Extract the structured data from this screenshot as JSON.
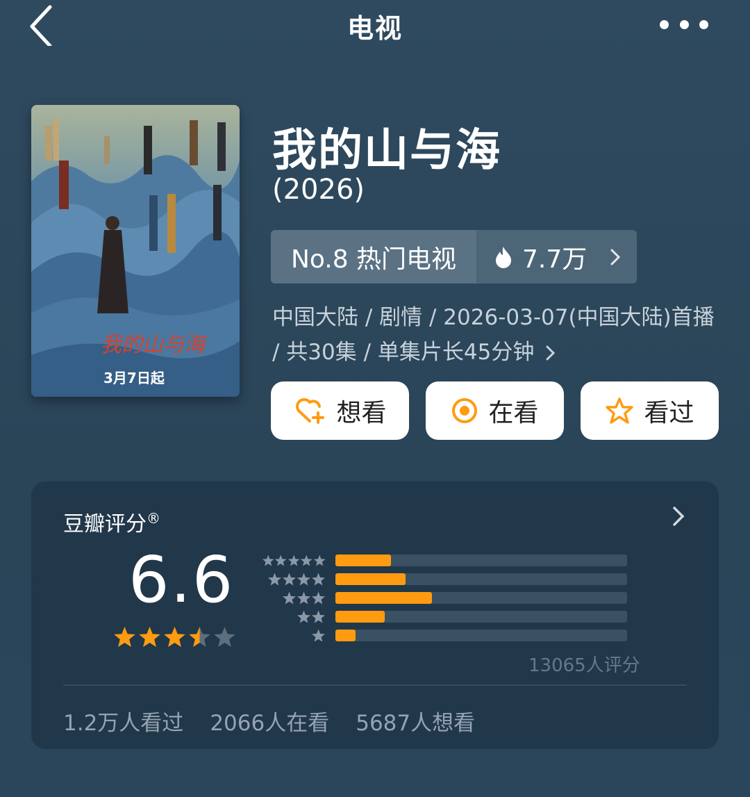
{
  "header": {
    "title": "电视"
  },
  "movie": {
    "name": "我的山与海",
    "year": "(2026)",
    "rank": "No.8 热门电视",
    "heat": "7.7万",
    "meta": "中国大陆 / 剧情 / 2026-03-07(中国大陆)首播 / 共30集 / 单集片长45分钟",
    "poster": {
      "title_art": "我的山与海",
      "date": "3月7日起"
    }
  },
  "actions": [
    {
      "label": "想看",
      "icon": "heart-plus-icon"
    },
    {
      "label": "在看",
      "icon": "target-icon"
    },
    {
      "label": "看过",
      "icon": "star-outline-icon"
    }
  ],
  "rating": {
    "title": "豆瓣评分",
    "mark": "®",
    "score": "6.6",
    "stars_value": 3.5,
    "distribution": [
      {
        "stars": 5,
        "fraction": 0.19
      },
      {
        "stars": 4,
        "fraction": 0.24
      },
      {
        "stars": 3,
        "fraction": 0.33
      },
      {
        "stars": 2,
        "fraction": 0.17
      },
      {
        "stars": 1,
        "fraction": 0.07
      }
    ],
    "count_text": "13065人评分",
    "stats": [
      "1.2万人看过",
      "2066人在看",
      "5687人想看"
    ]
  },
  "colors": {
    "accent": "#ff9b10",
    "bg": "#2f4a5f",
    "card": "#21374a"
  }
}
